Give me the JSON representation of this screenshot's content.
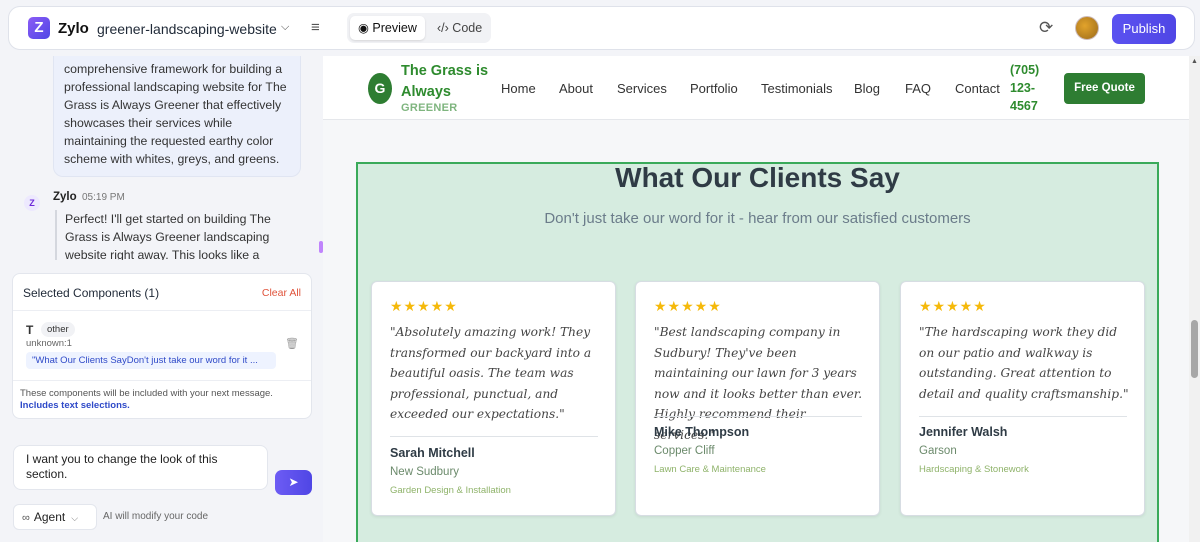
{
  "topbar": {
    "logo_letter": "Z",
    "app_name": "Zylo",
    "project_name": "greener-landscaping-website",
    "preview_label": "Preview",
    "code_label": "Code",
    "publish_label": "Publish"
  },
  "chat": {
    "prev_message": "comprehensive framework for building a professional landscaping website for The Grass is Always Greener that effectively showcases their services while maintaining the requested earthy color scheme with whites, greys, and greens.",
    "sender": "Zylo",
    "time": "05:19 PM",
    "message": "Perfect! I'll get started on building The Grass is Always Greener landscaping website right away. This looks like a fantastic project and"
  },
  "selected": {
    "title": "Selected Components (1)",
    "clear_label": "Clear All",
    "item_type": "T",
    "item_tag": "other",
    "item_source": "unknown:1",
    "item_text": "\"What Our Clients SayDon't just take our word for it ...",
    "note": "These components will be included with your next message.",
    "note_link": "Includes text selections."
  },
  "composer": {
    "input_value": "I want you to change the look of this section.",
    "mode_label": "Agent",
    "mode_note": "AI will modify your code"
  },
  "site": {
    "logo_letter": "G",
    "brand_line1": "The Grass is",
    "brand_line2": "Always",
    "brand_sub": "GREENER",
    "nav": [
      "Home",
      "About",
      "Services",
      "Portfolio",
      "Testimonials",
      "Blog",
      "FAQ",
      "Contact"
    ],
    "phone_line1": "(705)",
    "phone_line2": "123-",
    "phone_line3": "4567",
    "cta_label": "Free Quote"
  },
  "testimonials": {
    "title": "What Our Clients Say",
    "subtitle": "Don't just take our word for it - hear from our satisfied customers",
    "stars": "★★★★★",
    "cards": [
      {
        "quote": "\"Absolutely amazing work! They transformed our backyard into a beautiful oasis. The team was professional, punctual, and exceeded our expectations.\"",
        "name": "Sarah Mitchell",
        "location": "New Sudbury",
        "service": "Garden Design & Installation"
      },
      {
        "quote": "\"Best landscaping company in Sudbury! They've been maintaining our lawn for 3 years now and it looks better than ever. Highly recommend their services.\"",
        "name": "Mike Thompson",
        "location": "Copper Cliff",
        "service": "Lawn Care & Maintenance"
      },
      {
        "quote": "\"The hardscaping work they did on our patio and walkway is outstanding. Great attention to detail and quality craftsmanship.\"",
        "name": "Jennifer Walsh",
        "location": "Garson",
        "service": "Hardscaping & Stonework"
      }
    ]
  },
  "colors": {
    "accent": "#4f46e5",
    "brand_green": "#2e7d32",
    "section_bg": "#d6ece0",
    "star": "#f5b90a"
  }
}
